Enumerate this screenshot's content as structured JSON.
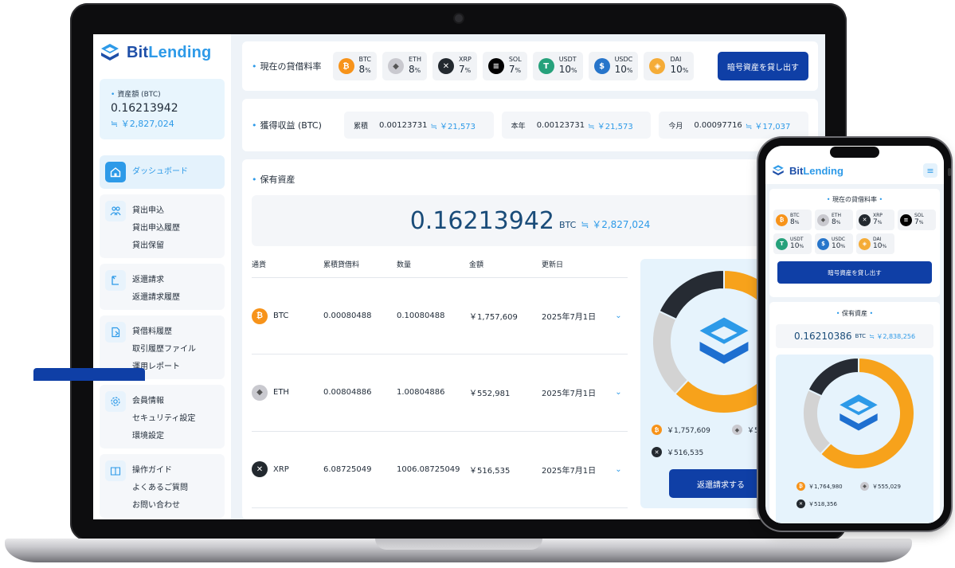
{
  "brand": {
    "name_a": "Bit",
    "name_b": "Lending"
  },
  "sidebar": {
    "asset_label": "資産額 (BTC)",
    "asset_btc": "0.16213942",
    "asset_jpy": "≒ ￥2,827,024",
    "active": {
      "label": "ダッシュボード",
      "icon": "home-icon"
    },
    "groups": [
      {
        "icon": "people-icon",
        "items": [
          "貸出申込",
          "貸出申込履歴",
          "貸出保留"
        ]
      },
      {
        "icon": "return-icon",
        "items": [
          "返還請求",
          "返還請求履歴"
        ]
      },
      {
        "icon": "document-icon",
        "items": [
          "貸借料履歴",
          "取引履歴ファイル",
          "運用レポート"
        ]
      },
      {
        "icon": "gear-icon",
        "items": [
          "会員情報",
          "セキュリティ設定",
          "環境設定"
        ]
      },
      {
        "icon": "book-icon",
        "items": [
          "操作ガイド",
          "よくあるご質問",
          "お問い合わせ"
        ]
      }
    ]
  },
  "rates": {
    "title": "現在の貸借料率",
    "items": [
      {
        "sym": "BTC",
        "value": "8",
        "unit": "%",
        "color": "#f7931a",
        "glyph": "₿"
      },
      {
        "sym": "ETH",
        "value": "8",
        "unit": "%",
        "color": "#c9c9cf",
        "glyph": "◆"
      },
      {
        "sym": "XRP",
        "value": "7",
        "unit": "%",
        "color": "#23292f",
        "glyph": "✕"
      },
      {
        "sym": "SOL",
        "value": "7",
        "unit": "%",
        "color": "#000000",
        "glyph": "≡"
      },
      {
        "sym": "USDT",
        "value": "10",
        "unit": "%",
        "color": "#26a17b",
        "glyph": "T"
      },
      {
        "sym": "USDC",
        "value": "10",
        "unit": "%",
        "color": "#2775ca",
        "glyph": "$"
      },
      {
        "sym": "DAI",
        "value": "10",
        "unit": "%",
        "color": "#f5ac37",
        "glyph": "◈"
      }
    ],
    "lend_button": "暗号資産を貸し出す"
  },
  "earnings": {
    "title": "獲得収益 (BTC)",
    "boxes": [
      {
        "key": "累積",
        "btc": "0.00123731",
        "jpy": "≒ ￥21,573"
      },
      {
        "key": "本年",
        "btc": "0.00123731",
        "jpy": "≒ ￥21,573"
      },
      {
        "key": "今月",
        "btc": "0.00097716",
        "jpy": "≒ ￥17,037"
      }
    ]
  },
  "holdings": {
    "title": "保有資産",
    "total_btc": "0.16213942",
    "unit": "BTC",
    "total_jpy": "≒ ￥2,827,024",
    "headers": [
      "通貨",
      "累積貸借料",
      "数量",
      "金額",
      "更新日"
    ],
    "rows": [
      {
        "coin": "BTC",
        "color": "#f7931a",
        "glyph": "₿",
        "fee": "0.00080488",
        "qty": "0.10080488",
        "amount": "￥1,757,609",
        "date": "2025年7月1日"
      },
      {
        "coin": "ETH",
        "color": "#c9c9cf",
        "glyph": "◆",
        "fee": "0.00804886",
        "qty": "1.00804886",
        "amount": "￥552,981",
        "date": "2025年7月1日"
      },
      {
        "coin": "XRP",
        "color": "#23292f",
        "glyph": "✕",
        "fee": "6.08725049",
        "qty": "1006.08725049",
        "amount": "￥516,535",
        "date": "2025年7月1日"
      }
    ],
    "legend": [
      "￥1,757,609",
      "￥5",
      "￥516,535"
    ],
    "return_button": "返還請求する",
    "donut_colors": {
      "btc": "#f7a21b",
      "eth": "#d3d3d3",
      "xrp": "#262b33"
    },
    "donut_share": {
      "btc": 0.62,
      "eth": 0.2,
      "xrp": 0.18
    }
  },
  "phone": {
    "rates_title": "現在の貸借料率",
    "lend_button": "暗号資産を貸し出す",
    "holdings_title": "保有資産",
    "total_btc": "0.16210386",
    "unit": "BTC",
    "total_jpy": "≒ ￥2,838,256",
    "legend": [
      "￥1,764,980",
      "￥555,029",
      "￥518,356"
    ]
  }
}
